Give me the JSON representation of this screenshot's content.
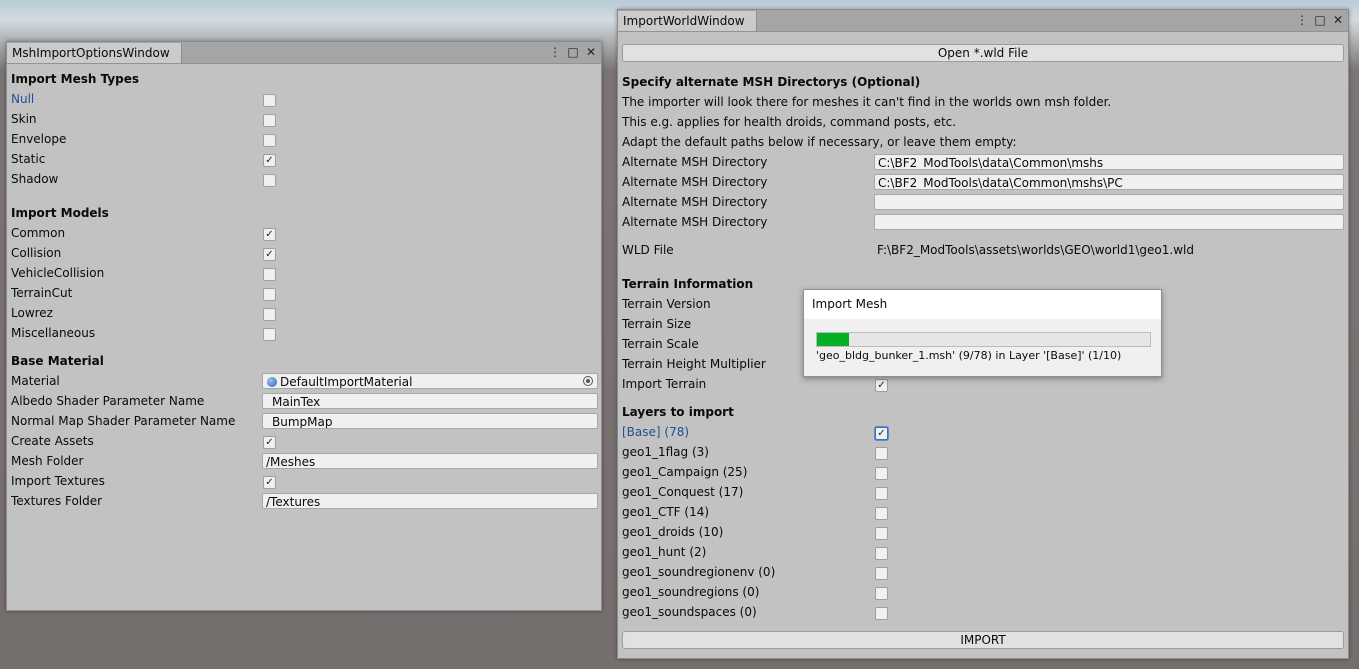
{
  "left_window": {
    "title": "MshImportOptionsWindow",
    "sections": {
      "mesh_types": "Import Mesh Types",
      "models": "Import Models",
      "base_material": "Base Material"
    },
    "mesh_types": [
      {
        "label": "Null",
        "checked": false,
        "highlight": true
      },
      {
        "label": "Skin",
        "checked": false
      },
      {
        "label": "Envelope",
        "checked": false
      },
      {
        "label": "Static",
        "checked": true
      },
      {
        "label": "Shadow",
        "checked": false
      }
    ],
    "models": [
      {
        "label": "Common",
        "checked": true
      },
      {
        "label": "Collision",
        "checked": true
      },
      {
        "label": "VehicleCollision",
        "checked": false
      },
      {
        "label": "TerrainCut",
        "checked": false
      },
      {
        "label": "Lowrez",
        "checked": false
      },
      {
        "label": "Miscellaneous",
        "checked": false
      }
    ],
    "material": {
      "material_label": "Material",
      "material_value": "DefaultImportMaterial",
      "albedo_label": "Albedo Shader Parameter Name",
      "albedo_value": "_MainTex",
      "normal_label": "Normal Map Shader Parameter Name",
      "normal_value": "_BumpMap",
      "create_assets_label": "Create Assets",
      "create_assets": true,
      "mesh_folder_label": "Mesh Folder",
      "mesh_folder_value": "/Meshes",
      "import_textures_label": "Import Textures",
      "import_textures": true,
      "textures_folder_label": "Textures Folder",
      "textures_folder_value": "/Textures"
    }
  },
  "right_window": {
    "title": "ImportWorldWindow",
    "open_button": "Open *.wld File",
    "alt_heading": "Specify alternate MSH Directorys (Optional)",
    "info_lines": [
      "The importer will look there for meshes it can't find in the worlds own msh folder.",
      "This e.g. applies for health droids, command posts, etc.",
      "Adapt the default paths below if necessary, or leave them empty:"
    ],
    "alt_dirs": [
      {
        "label": "Alternate MSH Directory",
        "value": "C:\\BF2_ModTools\\data\\Common\\mshs"
      },
      {
        "label": "Alternate MSH Directory",
        "value": "C:\\BF2_ModTools\\data\\Common\\mshs\\PC"
      },
      {
        "label": "Alternate MSH Directory",
        "value": ""
      },
      {
        "label": "Alternate MSH Directory",
        "value": ""
      }
    ],
    "wld_label": "WLD File",
    "wld_value": "F:\\BF2_ModTools\\assets\\worlds\\GEO\\world1\\geo1.wld",
    "terrain_heading": "Terrain Information",
    "terrain_rows": [
      "Terrain Version",
      "Terrain Size",
      "Terrain Scale",
      "Terrain Height Multiplier"
    ],
    "import_terrain_label": "Import Terrain",
    "import_terrain": true,
    "layers_heading": "Layers to import",
    "layers": [
      {
        "label": "[Base]  (78)",
        "checked": true,
        "highlight": true
      },
      {
        "label": "geo1_1flag  (3)",
        "checked": false
      },
      {
        "label": "geo1_Campaign  (25)",
        "checked": false
      },
      {
        "label": "geo1_Conquest  (17)",
        "checked": false
      },
      {
        "label": "geo1_CTF  (14)",
        "checked": false
      },
      {
        "label": "geo1_droids  (10)",
        "checked": false
      },
      {
        "label": "geo1_hunt  (2)",
        "checked": false
      },
      {
        "label": "geo1_soundregionenv  (0)",
        "checked": false
      },
      {
        "label": "geo1_soundregions  (0)",
        "checked": false
      },
      {
        "label": "geo1_soundspaces  (0)",
        "checked": false
      }
    ],
    "import_button": "IMPORT"
  },
  "dialog": {
    "title": "Import Mesh",
    "progress_fraction": 0.097,
    "message": "'geo_bldg_bunker_1.msh' (9/78) in Layer '[Base]' (1/10)",
    "progress_color": "#06b025"
  },
  "window_buttons": {
    "menu": "⋮",
    "maximize": "□",
    "close": "✕"
  }
}
